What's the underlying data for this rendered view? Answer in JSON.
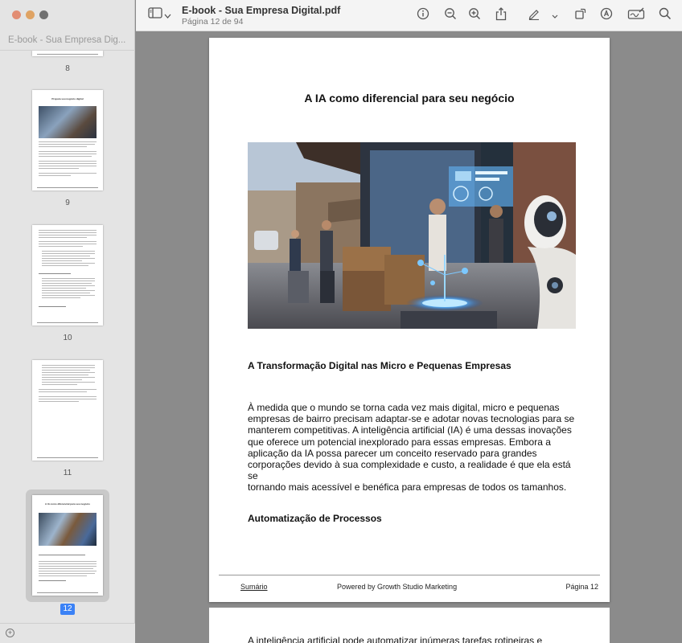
{
  "sidebar": {
    "title": "E-book - Sua Empresa Dig...",
    "thumbnails": [
      {
        "number": "8"
      },
      {
        "number": "9",
        "heading": "Prepara seu negócio digital"
      },
      {
        "number": "10"
      },
      {
        "number": "11"
      },
      {
        "number": "12",
        "heading": "A IA como diferencial para seu negócio"
      }
    ]
  },
  "toolbar": {
    "title": "E-book - Sua Empresa Digital.pdf",
    "subtitle": "Página 12 de 94"
  },
  "page": {
    "title": "A IA como diferencial para seu negócio",
    "section1_heading": "A Transformação Digital nas Micro e Pequenas Empresas",
    "section1_lines": [
      "À medida que o mundo se torna cada vez mais digital, micro e pequenas",
      "empresas de bairro precisam adaptar-se e adotar novas tecnologias para se",
      "manterem competitivas. A inteligência artificial (IA) é uma dessas inovações",
      "que oferece um potencial inexplorado para essas empresas. Embora a",
      "aplicação da IA possa parecer um conceito reservado para grandes",
      "corporações devido à sua complexidade e custo, a realidade é que ela está se",
      "tornando mais acessível e benéfica para empresas de todos os tamanhos."
    ],
    "section2_heading": "Automatização de Processos",
    "footer_left": "Sumário",
    "footer_center": "Powered by Growth Studio Marketing",
    "footer_right": "Página 12"
  },
  "next_page": {
    "first_line": "A inteligência artificial pode automatizar inúmeras tarefas rotineiras e"
  },
  "icons": [
    "sidebar-toggle-icon",
    "chevron-down-icon",
    "info-icon",
    "zoom-out-icon",
    "zoom-in-icon",
    "share-icon",
    "markup-pen-icon",
    "rotate-icon",
    "annotate-icon",
    "signature-icon",
    "search-icon",
    "add-icon"
  ]
}
